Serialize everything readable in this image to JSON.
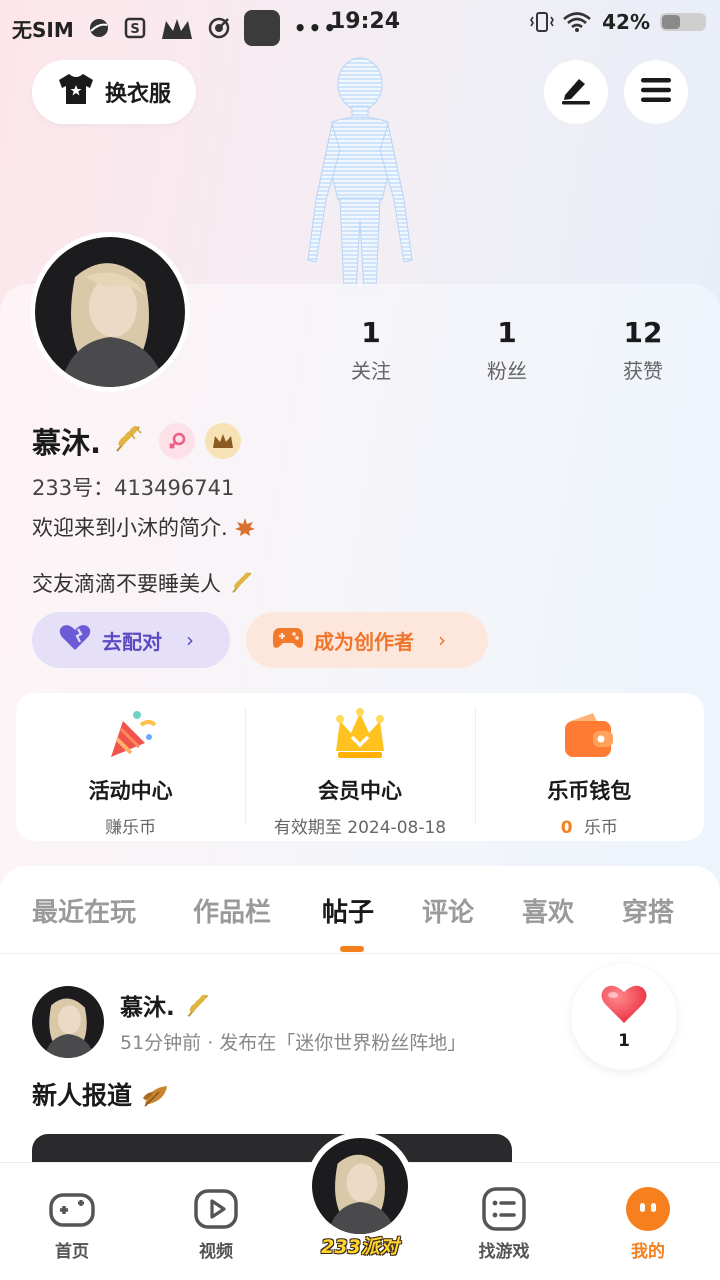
{
  "status_bar": {
    "carrier": "无SIM",
    "time": "19:24",
    "battery": "42%",
    "battery_level": 0.42
  },
  "header": {
    "outfit_label": "换衣服",
    "edit_icon": "edit-icon",
    "menu_icon": "menu-icon"
  },
  "profile": {
    "stats": [
      {
        "value": "1",
        "label": "关注"
      },
      {
        "value": "1",
        "label": "粉丝"
      },
      {
        "value": "12",
        "label": "获赞"
      }
    ],
    "name": "慕沐.",
    "uid": "233号：413496741",
    "bio_line1": "欢迎来到小沐的简介.",
    "bio_line2": "交友滴滴不要睡美人"
  },
  "actions": {
    "match_label": "去配对",
    "creator_label": "成为创作者"
  },
  "features": [
    {
      "title": "活动中心",
      "sub": "赚乐币",
      "icon": "party-icon"
    },
    {
      "title": "会员中心",
      "sub": "有效期至 2024-08-18",
      "icon": "crown-icon"
    },
    {
      "title": "乐币钱包",
      "sub_value": "0",
      "sub_unit": "乐币",
      "icon": "wallet-icon"
    }
  ],
  "tabs": [
    "最近在玩",
    "作品栏",
    "帖子",
    "评论",
    "喜欢",
    "穿搭"
  ],
  "active_tab": "帖子",
  "post": {
    "author": "慕沐.",
    "meta": "51分钟前 · 发布在「迷你世界粉丝阵地」",
    "title": "新人报道",
    "likes": "1"
  },
  "bottom_nav": {
    "items": [
      "首页",
      "视频",
      "找游戏",
      "我的"
    ],
    "center_label": "233派对",
    "active": "我的"
  },
  "colors": {
    "accent": "#f67f1e",
    "match_pill": "#e5e0f7",
    "creator_pill": "#fde7dc",
    "heart": "#f2434f"
  }
}
